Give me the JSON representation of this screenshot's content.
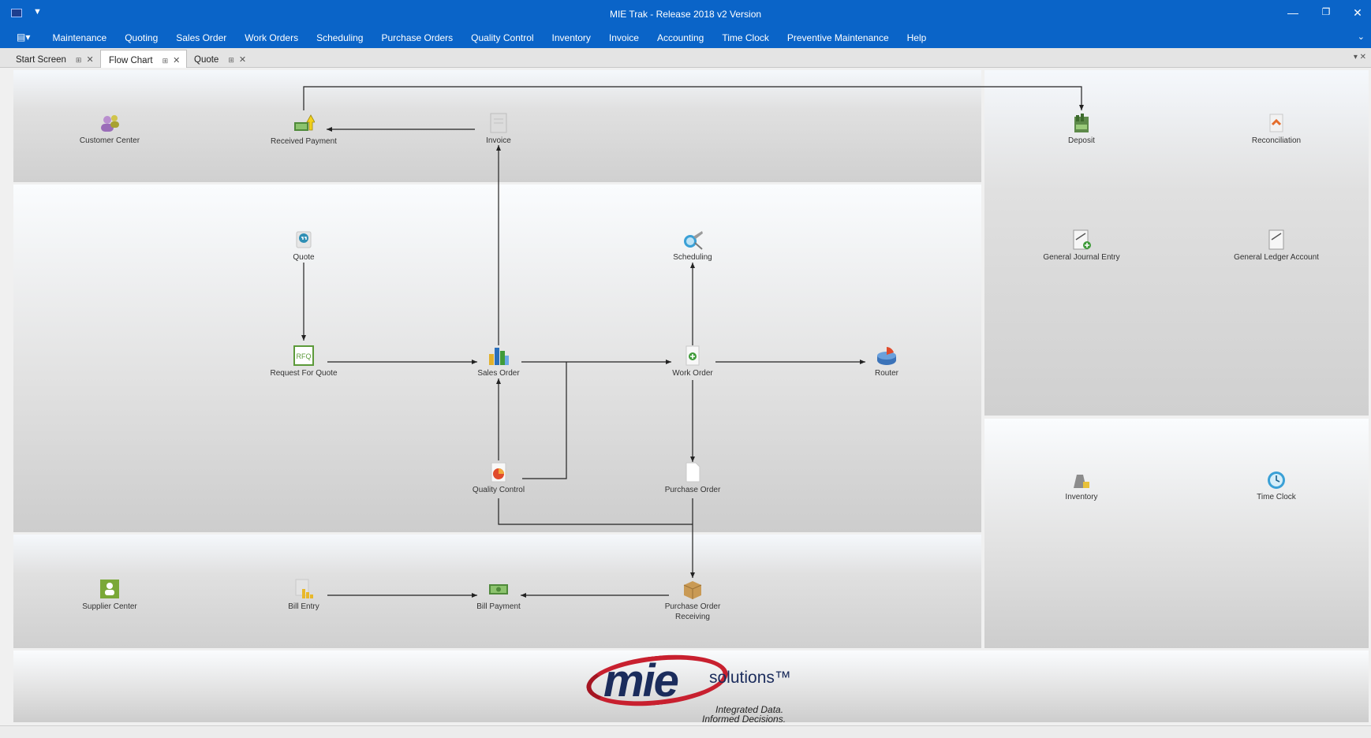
{
  "window": {
    "title": "MIE Trak - Release 2018 v2 Version",
    "minimize": "—",
    "restore": "❐",
    "close": "✕"
  },
  "menu": {
    "app_menu_icon": "▤▾",
    "items": [
      "Maintenance",
      "Quoting",
      "Sales Order",
      "Work Orders",
      "Scheduling",
      "Purchase Orders",
      "Quality Control",
      "Inventory",
      "Invoice",
      "Accounting",
      "Time Clock",
      "Preventive Maintenance",
      "Help"
    ],
    "expander": "⌄"
  },
  "tabs": [
    {
      "label": "Start Screen",
      "pin": "⊞",
      "close": "✕"
    },
    {
      "label": "Flow Chart",
      "pin": "⊞",
      "close": "✕"
    },
    {
      "label": "Quote",
      "pin": "⊞",
      "close": "✕"
    }
  ],
  "tabbar_controls": "▾ ✕",
  "nodes": {
    "customer_center": {
      "label": "Customer Center",
      "icon": "users-icon"
    },
    "received_payment": {
      "label": "Received Payment",
      "icon": "money-arrow-icon"
    },
    "invoice": {
      "label": "Invoice",
      "icon": "invoice-icon"
    },
    "deposit": {
      "label": "Deposit",
      "icon": "deposit-icon"
    },
    "reconciliation": {
      "label": "Reconciliation",
      "icon": "reconciliation-icon"
    },
    "quote": {
      "label": "Quote",
      "icon": "quote-icon"
    },
    "scheduling": {
      "label": "Scheduling",
      "icon": "scheduling-icon"
    },
    "general_journal_entry": {
      "label": "General Journal Entry",
      "icon": "journal-icon"
    },
    "general_ledger_account": {
      "label": "General Ledger Account",
      "icon": "ledger-icon"
    },
    "request_for_quote": {
      "label": "Request For Quote",
      "icon": "rfq-icon"
    },
    "sales_order": {
      "label": "Sales Order",
      "icon": "bar-chart-icon"
    },
    "work_order": {
      "label": "Work Order",
      "icon": "work-order-icon"
    },
    "router": {
      "label": "Router",
      "icon": "router-icon"
    },
    "quality_control": {
      "label": "Quality Control",
      "icon": "pie-chart-icon"
    },
    "purchase_order": {
      "label": "Purchase Order",
      "icon": "document-icon"
    },
    "inventory": {
      "label": "Inventory",
      "icon": "inventory-icon"
    },
    "time_clock": {
      "label": "Time Clock",
      "icon": "clock-icon"
    },
    "supplier_center": {
      "label": "Supplier Center",
      "icon": "supplier-icon"
    },
    "bill_entry": {
      "label": "Bill Entry",
      "icon": "bill-icon"
    },
    "bill_payment": {
      "label": "Bill Payment",
      "icon": "cash-icon"
    },
    "purchase_order_receiving": {
      "label": "Purchase Order Receiving",
      "icon": "box-icon"
    }
  },
  "logo": {
    "brand": "mie",
    "solutions": "solutions™",
    "tagline_1": "Integrated Data.",
    "tagline_2": "Informed Decisions."
  },
  "colors": {
    "title_bar": "#0a64c8",
    "logo_red": "#c8202f",
    "logo_navy": "#1b2c5c"
  }
}
